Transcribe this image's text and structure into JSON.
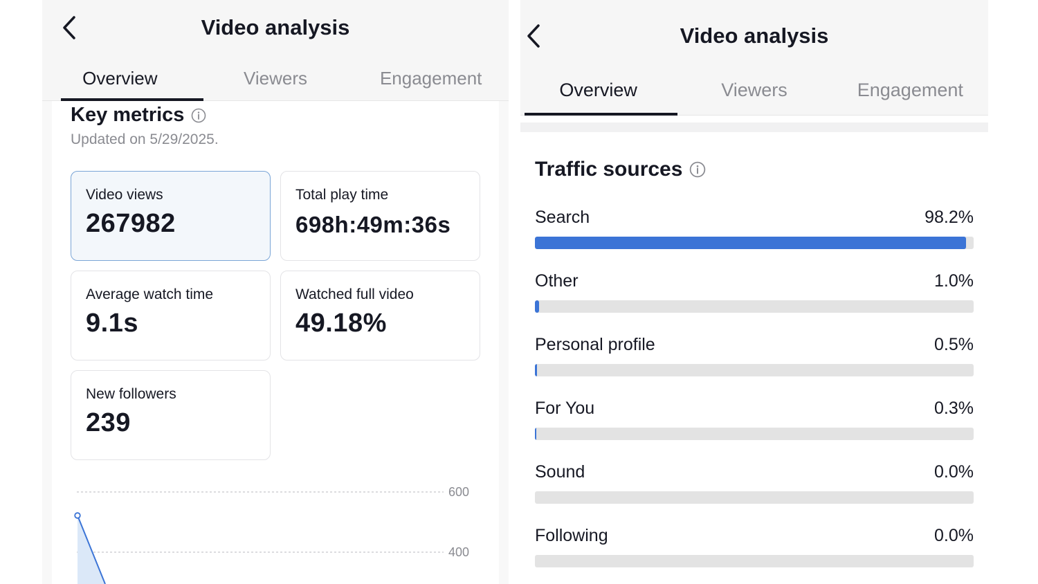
{
  "left_screen": {
    "title": "Video analysis",
    "tabs": [
      "Overview",
      "Viewers",
      "Engagement"
    ],
    "active_tab": "Overview",
    "key_metrics": {
      "title": "Key metrics",
      "updated": "Updated on 5/29/2025.",
      "cards": [
        {
          "label": "Video views",
          "value": "267982",
          "selected": true
        },
        {
          "label": "Total play time",
          "value": "698h:49m:36s",
          "selected": false
        },
        {
          "label": "Average watch time",
          "value": "9.1s",
          "selected": false
        },
        {
          "label": "Watched full video",
          "value": "49.18%",
          "selected": false
        },
        {
          "label": "New followers",
          "value": "239",
          "selected": false
        }
      ]
    },
    "chart": {
      "y_tick_labels": [
        "600",
        "400"
      ],
      "accent_color": "#3b74d6"
    }
  },
  "right_screen": {
    "title": "Video analysis",
    "tabs": [
      "Overview",
      "Viewers",
      "Engagement"
    ],
    "active_tab": "Overview",
    "traffic_sources": {
      "title": "Traffic sources",
      "items": [
        {
          "name": "Search",
          "percent_label": "98.2%",
          "value": 98.2
        },
        {
          "name": "Other",
          "percent_label": "1.0%",
          "value": 1.0
        },
        {
          "name": "Personal profile",
          "percent_label": "0.5%",
          "value": 0.5
        },
        {
          "name": "For You",
          "percent_label": "0.3%",
          "value": 0.3
        },
        {
          "name": "Sound",
          "percent_label": "0.0%",
          "value": 0.0
        },
        {
          "name": "Following",
          "percent_label": "0.0%",
          "value": 0.0
        }
      ],
      "bar_color": "#3b74d6",
      "track_color": "#e3e3e3"
    }
  },
  "icons": {
    "back": "chevron-left-icon",
    "info": "info-circle-icon"
  }
}
